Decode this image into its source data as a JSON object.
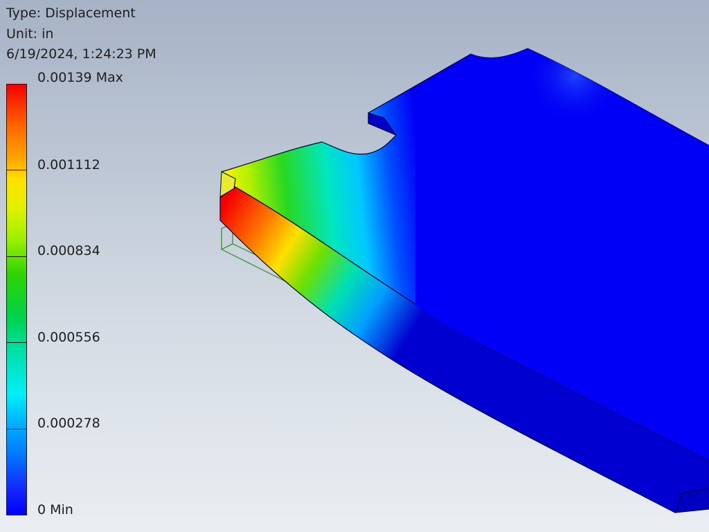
{
  "header": {
    "type_line": "Type: Displacement",
    "unit_line": "Unit: in",
    "timestamp_line": "6/19/2024, 1:24:23 PM"
  },
  "legend": {
    "labels": [
      "0.00139 Max",
      "0.001112",
      "0.000834",
      "0.000556",
      "0.000278",
      "0 Min"
    ],
    "colors": [
      "#f40000",
      "#ffe000",
      "#2ed400",
      "#00f0f8",
      "#0000f6"
    ]
  },
  "result": {
    "max_value": 0.00139,
    "min_value": 0,
    "unit": "in"
  },
  "model_colors": {
    "body": "#0000f6",
    "body_dark": "#0000b4",
    "outline": "#000030",
    "undeformed_outline": "#2a8a2a"
  }
}
